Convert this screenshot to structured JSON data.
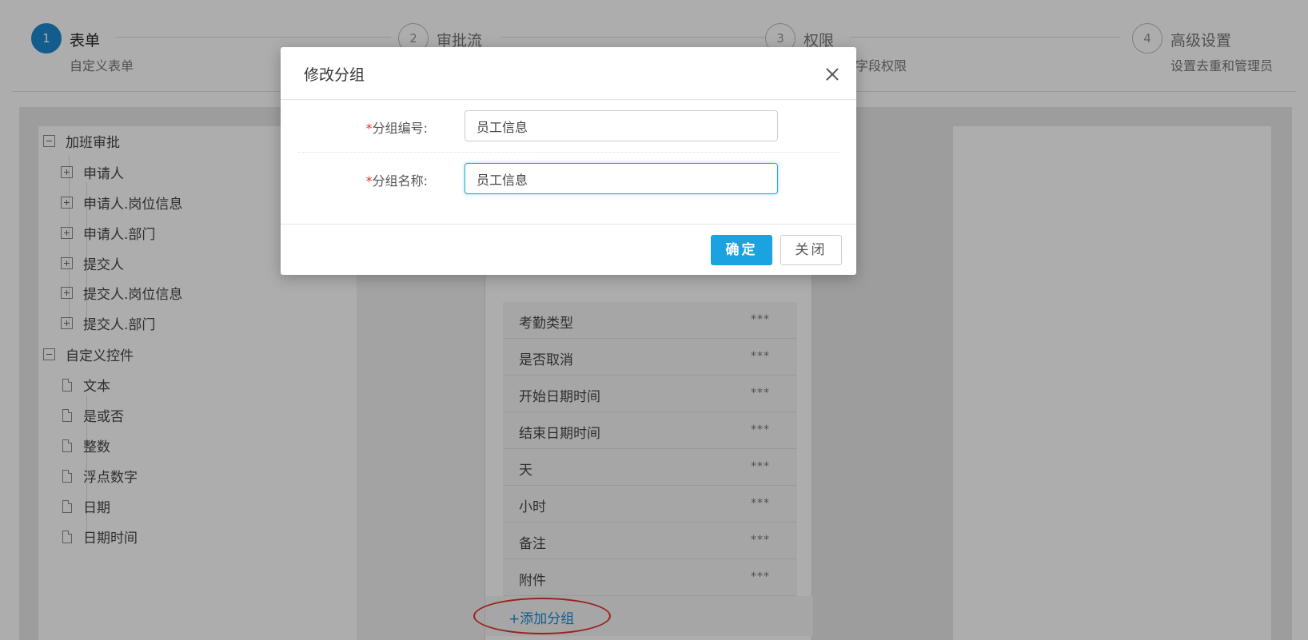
{
  "steps": [
    {
      "num": "1",
      "title": "表单",
      "desc": "自定义表单",
      "active": true
    },
    {
      "num": "2",
      "title": "审批流",
      "desc": "",
      "active": false
    },
    {
      "num": "3",
      "title": "权限",
      "desc": "字段权限",
      "active": false
    },
    {
      "num": "4",
      "title": "高级设置",
      "desc": "设置去重和管理员",
      "active": false
    }
  ],
  "tree": {
    "group1": "加班审批",
    "group1_items": [
      "申请人",
      "申请人.岗位信息",
      "申请人.部门",
      "提交人",
      "提交人.岗位信息",
      "提交人.部门"
    ],
    "group2": "自定义控件",
    "group2_items": [
      "文本",
      "是或否",
      "整数",
      "浮点数字",
      "日期",
      "日期时间"
    ]
  },
  "fields": [
    {
      "label": "考勤类型",
      "value": "***"
    },
    {
      "label": "是否取消",
      "value": "***"
    },
    {
      "label": "开始日期时间",
      "value": "***"
    },
    {
      "label": "结束日期时间",
      "value": "***"
    },
    {
      "label": "天",
      "value": "***"
    },
    {
      "label": "小时",
      "value": "***"
    },
    {
      "label": "备注",
      "value": "***"
    },
    {
      "label": "附件",
      "value": "***"
    }
  ],
  "add_group_label": "+添加分组",
  "modal": {
    "title": "修改分组",
    "code_required": "*",
    "code_label": "分组编号:",
    "code_value": "员工信息",
    "name_required": "*",
    "name_label": "分组名称:",
    "name_value": "员工信息",
    "confirm_label": "确定",
    "close_label": "关闭"
  },
  "colors": {
    "primary": "#1aa3e0",
    "step_active": "#1c8ad1",
    "required": "#e5302b",
    "annotation": "#e5302b"
  }
}
